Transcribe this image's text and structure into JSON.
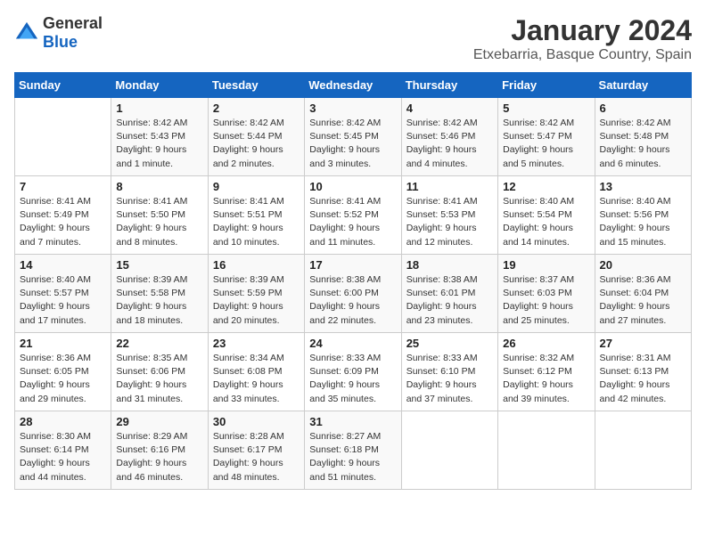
{
  "logo": {
    "text_general": "General",
    "text_blue": "Blue"
  },
  "title": "January 2024",
  "subtitle": "Etxebarria, Basque Country, Spain",
  "weekdays": [
    "Sunday",
    "Monday",
    "Tuesday",
    "Wednesday",
    "Thursday",
    "Friday",
    "Saturday"
  ],
  "weeks": [
    [
      {
        "day": "",
        "info": ""
      },
      {
        "day": "1",
        "info": "Sunrise: 8:42 AM\nSunset: 5:43 PM\nDaylight: 9 hours\nand 1 minute."
      },
      {
        "day": "2",
        "info": "Sunrise: 8:42 AM\nSunset: 5:44 PM\nDaylight: 9 hours\nand 2 minutes."
      },
      {
        "day": "3",
        "info": "Sunrise: 8:42 AM\nSunset: 5:45 PM\nDaylight: 9 hours\nand 3 minutes."
      },
      {
        "day": "4",
        "info": "Sunrise: 8:42 AM\nSunset: 5:46 PM\nDaylight: 9 hours\nand 4 minutes."
      },
      {
        "day": "5",
        "info": "Sunrise: 8:42 AM\nSunset: 5:47 PM\nDaylight: 9 hours\nand 5 minutes."
      },
      {
        "day": "6",
        "info": "Sunrise: 8:42 AM\nSunset: 5:48 PM\nDaylight: 9 hours\nand 6 minutes."
      }
    ],
    [
      {
        "day": "7",
        "info": "Sunrise: 8:41 AM\nSunset: 5:49 PM\nDaylight: 9 hours\nand 7 minutes."
      },
      {
        "day": "8",
        "info": "Sunrise: 8:41 AM\nSunset: 5:50 PM\nDaylight: 9 hours\nand 8 minutes."
      },
      {
        "day": "9",
        "info": "Sunrise: 8:41 AM\nSunset: 5:51 PM\nDaylight: 9 hours\nand 10 minutes."
      },
      {
        "day": "10",
        "info": "Sunrise: 8:41 AM\nSunset: 5:52 PM\nDaylight: 9 hours\nand 11 minutes."
      },
      {
        "day": "11",
        "info": "Sunrise: 8:41 AM\nSunset: 5:53 PM\nDaylight: 9 hours\nand 12 minutes."
      },
      {
        "day": "12",
        "info": "Sunrise: 8:40 AM\nSunset: 5:54 PM\nDaylight: 9 hours\nand 14 minutes."
      },
      {
        "day": "13",
        "info": "Sunrise: 8:40 AM\nSunset: 5:56 PM\nDaylight: 9 hours\nand 15 minutes."
      }
    ],
    [
      {
        "day": "14",
        "info": "Sunrise: 8:40 AM\nSunset: 5:57 PM\nDaylight: 9 hours\nand 17 minutes."
      },
      {
        "day": "15",
        "info": "Sunrise: 8:39 AM\nSunset: 5:58 PM\nDaylight: 9 hours\nand 18 minutes."
      },
      {
        "day": "16",
        "info": "Sunrise: 8:39 AM\nSunset: 5:59 PM\nDaylight: 9 hours\nand 20 minutes."
      },
      {
        "day": "17",
        "info": "Sunrise: 8:38 AM\nSunset: 6:00 PM\nDaylight: 9 hours\nand 22 minutes."
      },
      {
        "day": "18",
        "info": "Sunrise: 8:38 AM\nSunset: 6:01 PM\nDaylight: 9 hours\nand 23 minutes."
      },
      {
        "day": "19",
        "info": "Sunrise: 8:37 AM\nSunset: 6:03 PM\nDaylight: 9 hours\nand 25 minutes."
      },
      {
        "day": "20",
        "info": "Sunrise: 8:36 AM\nSunset: 6:04 PM\nDaylight: 9 hours\nand 27 minutes."
      }
    ],
    [
      {
        "day": "21",
        "info": "Sunrise: 8:36 AM\nSunset: 6:05 PM\nDaylight: 9 hours\nand 29 minutes."
      },
      {
        "day": "22",
        "info": "Sunrise: 8:35 AM\nSunset: 6:06 PM\nDaylight: 9 hours\nand 31 minutes."
      },
      {
        "day": "23",
        "info": "Sunrise: 8:34 AM\nSunset: 6:08 PM\nDaylight: 9 hours\nand 33 minutes."
      },
      {
        "day": "24",
        "info": "Sunrise: 8:33 AM\nSunset: 6:09 PM\nDaylight: 9 hours\nand 35 minutes."
      },
      {
        "day": "25",
        "info": "Sunrise: 8:33 AM\nSunset: 6:10 PM\nDaylight: 9 hours\nand 37 minutes."
      },
      {
        "day": "26",
        "info": "Sunrise: 8:32 AM\nSunset: 6:12 PM\nDaylight: 9 hours\nand 39 minutes."
      },
      {
        "day": "27",
        "info": "Sunrise: 8:31 AM\nSunset: 6:13 PM\nDaylight: 9 hours\nand 42 minutes."
      }
    ],
    [
      {
        "day": "28",
        "info": "Sunrise: 8:30 AM\nSunset: 6:14 PM\nDaylight: 9 hours\nand 44 minutes."
      },
      {
        "day": "29",
        "info": "Sunrise: 8:29 AM\nSunset: 6:16 PM\nDaylight: 9 hours\nand 46 minutes."
      },
      {
        "day": "30",
        "info": "Sunrise: 8:28 AM\nSunset: 6:17 PM\nDaylight: 9 hours\nand 48 minutes."
      },
      {
        "day": "31",
        "info": "Sunrise: 8:27 AM\nSunset: 6:18 PM\nDaylight: 9 hours\nand 51 minutes."
      },
      {
        "day": "",
        "info": ""
      },
      {
        "day": "",
        "info": ""
      },
      {
        "day": "",
        "info": ""
      }
    ]
  ]
}
